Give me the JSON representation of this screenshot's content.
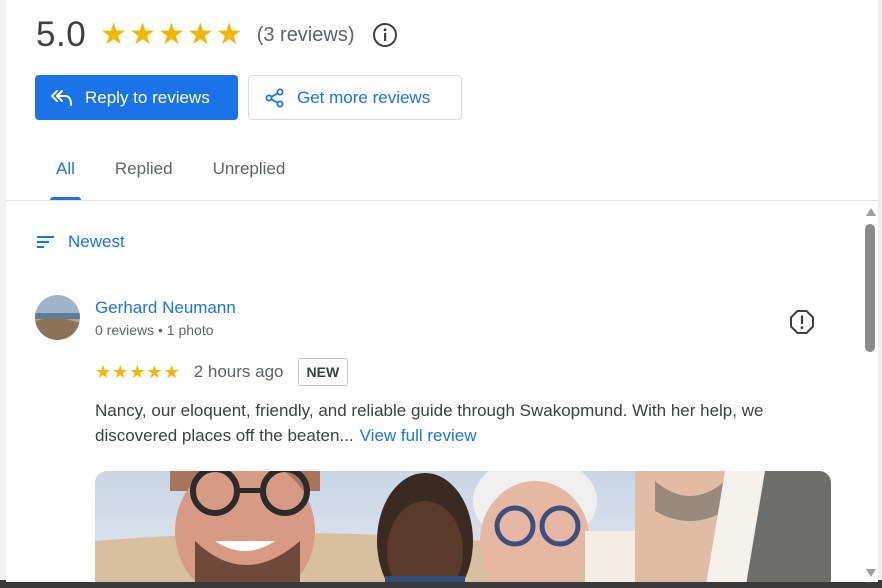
{
  "summary": {
    "rating": "5.0",
    "star_count": 5,
    "review_count": "(3 reviews)"
  },
  "actions": {
    "reply_label": "Reply to reviews",
    "more_label": "Get more reviews"
  },
  "tabs": [
    {
      "label": "All",
      "active": true
    },
    {
      "label": "Replied",
      "active": false
    },
    {
      "label": "Unreplied",
      "active": false
    }
  ],
  "sort": {
    "label": "Newest"
  },
  "review": {
    "name": "Gerhard Neumann",
    "meta": "0 reviews • 1 photo",
    "stars": 5,
    "time": "2 hours ago",
    "badge": "NEW",
    "text": "Nancy, our eloquent, friendly, and reliable guide through Swakopmund. With her help, we discovered places off the beaten...",
    "view_full": "View full review"
  },
  "colors": {
    "accent": "#1a73e8",
    "star": "#f5b400",
    "text": "#3c4043",
    "muted": "#5f6368"
  }
}
